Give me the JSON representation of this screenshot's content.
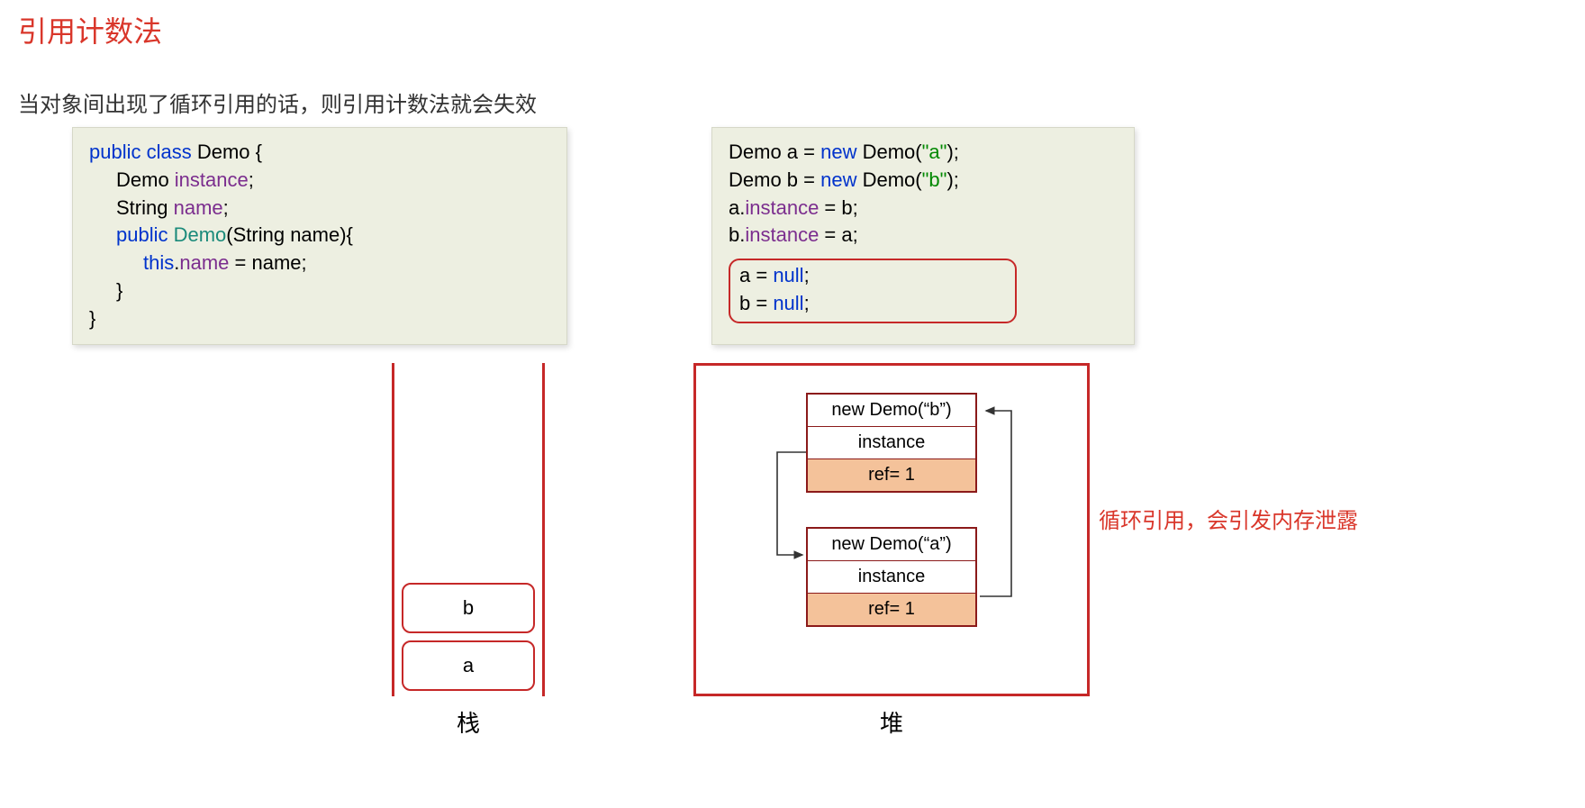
{
  "title": "引用计数法",
  "subtitle": "当对象间出现了循环引用的话，则引用计数法就会失效",
  "code_left": {
    "l1_public": "public",
    "l1_class": "class",
    "l1_name": " Demo {",
    "l2_type": "Demo ",
    "l2_field": "instance",
    "l2_end": ";",
    "l3_type": "String ",
    "l3_field": "name",
    "l3_end": ";",
    "l4_public": "public",
    "l4_ctor": " Demo",
    "l4_params": "(String name){",
    "l5_this": "this",
    "l5_dot": ".",
    "l5_field": "name",
    "l5_assign": " = name;",
    "l6": "}",
    "l7": "}"
  },
  "code_right": {
    "r1_a": "Demo a = ",
    "r1_new": "new",
    "r1_mid": " Demo(",
    "r1_str": "\"a\"",
    "r1_end": ");",
    "r2_a": "Demo b = ",
    "r2_new": "new",
    "r2_mid": " Demo(",
    "r2_str": "\"b\"",
    "r2_end": ");",
    "r3_a": "a.",
    "r3_field": "instance",
    "r3_end": " = b;",
    "r4_a": "b.",
    "r4_field": "instance",
    "r4_end": " = a;",
    "nb1_a": "a = ",
    "nb1_null": "null",
    "nb1_end": ";",
    "nb2_a": "b = ",
    "nb2_null": "null",
    "nb2_end": ";"
  },
  "stack": {
    "item_b": "b",
    "item_a": "a",
    "label": "栈"
  },
  "heap": {
    "obj_b": {
      "header": "new Demo(“b”)",
      "instance": "instance",
      "ref": "ref=  1"
    },
    "obj_a": {
      "header": "new Demo(“a”)",
      "instance": "instance",
      "ref": "ref=  1"
    },
    "label": "堆"
  },
  "annotation": "循环引用，会引发内存泄露"
}
